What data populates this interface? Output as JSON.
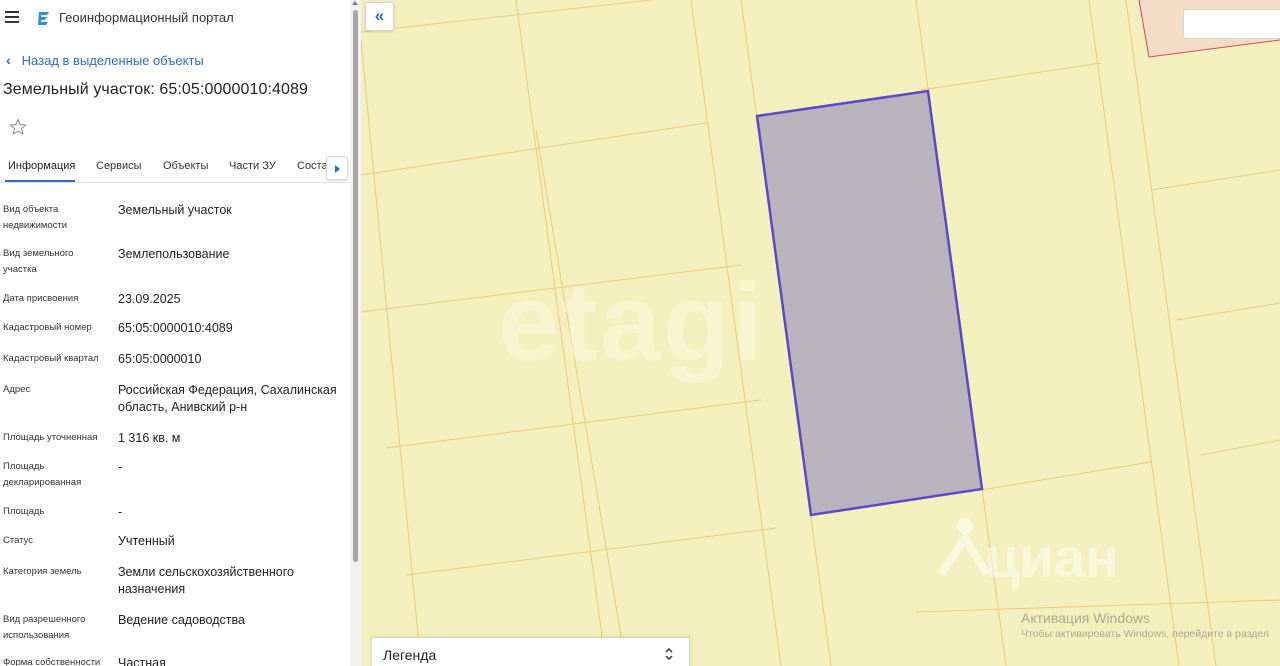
{
  "app": {
    "title": "Геоинформационный портал"
  },
  "nav": {
    "back_label": "Назад в выделенные объекты"
  },
  "object": {
    "title": "Земельный участок: 65:05:0000010:4089"
  },
  "tabs": [
    {
      "label": "Информация",
      "active": true
    },
    {
      "label": "Сервисы"
    },
    {
      "label": "Объекты"
    },
    {
      "label": "Части ЗУ"
    },
    {
      "label": "Соста"
    }
  ],
  "properties": [
    {
      "label": "Вид объекта недвижимости",
      "value": "Земельный участок"
    },
    {
      "label": "Вид земельного участка",
      "value": "Землепользование"
    },
    {
      "label": "Дата присвоения",
      "value": "23.09.2025"
    },
    {
      "label": "Кадастровый номер",
      "value": "65:05:0000010:4089"
    },
    {
      "label": "Кадастровый квартал",
      "value": "65:05:0000010"
    },
    {
      "label": "Адрес",
      "value": "Российская Федерация, Сахалинская область, Анивский р-н"
    },
    {
      "label": "Площадь уточненная",
      "value": "1 316 кв. м"
    },
    {
      "label": "Площадь декларированная",
      "value": "-"
    },
    {
      "label": "Площадь",
      "value": "-"
    },
    {
      "label": "Статус",
      "value": "Учтенный"
    },
    {
      "label": "Категория земель",
      "value": "Земли сельскохозяйственного назначения"
    },
    {
      "label": "Вид разрешенного использования",
      "value": "Ведение садоводства"
    },
    {
      "label": "Форма собственности",
      "value": "Частная"
    }
  ],
  "map": {
    "legend_label": "Легенда",
    "colors": {
      "background": "#f4f0bd",
      "parcel_border": "#ebc97a",
      "selected_fill": "#b9b3bd",
      "selected_border": "#5b47cc",
      "neighbor_fill": "#f3ddc6",
      "neighbor_border": "#d9474f"
    },
    "watermarks": {
      "etagi": "etagi",
      "cian": "циан"
    }
  },
  "windows_activation": {
    "title": "Активация Windows",
    "subtitle": "Чтобы активировать Windows, перейдите в раздел"
  },
  "icons": {
    "menu": "hamburger-icon",
    "logo": "portal-logo-icon",
    "back": "chevron-left-icon",
    "favorite": "star-outline-icon",
    "tabs_next": "caret-right-icon",
    "collapse": "double-chevron-left-icon",
    "legend_toggle": "chevron-up-down-icon"
  }
}
